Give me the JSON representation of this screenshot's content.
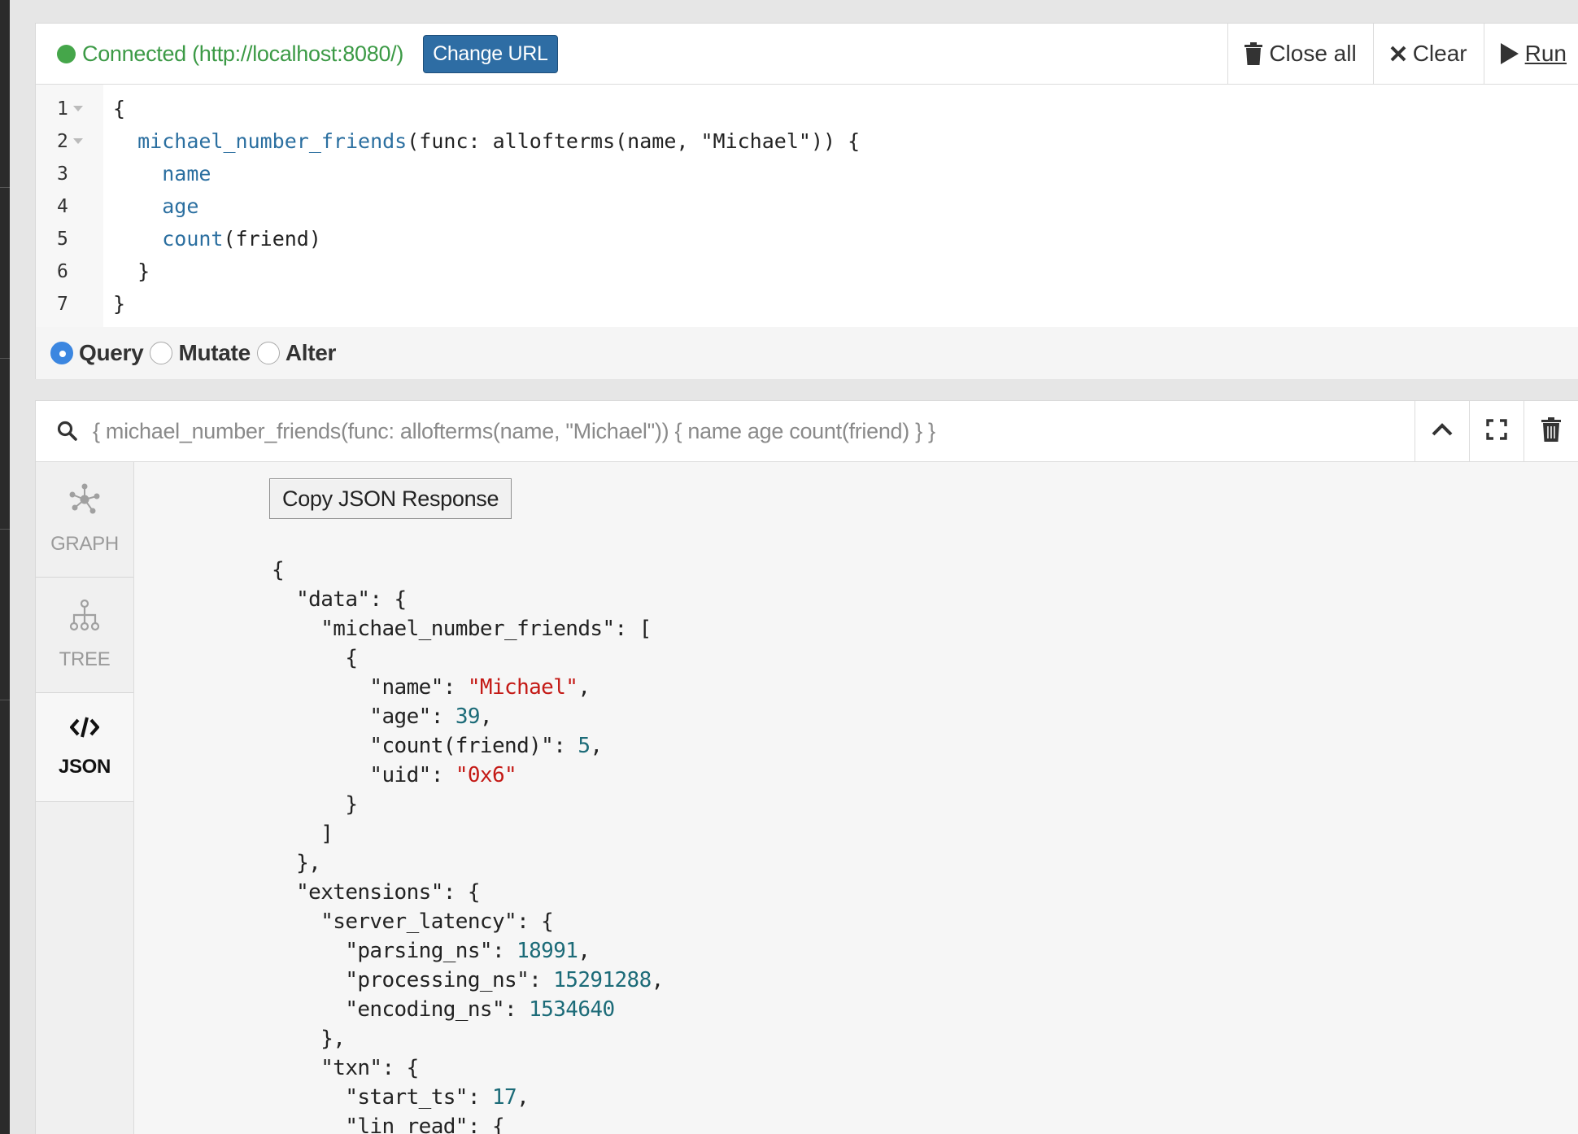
{
  "connection": {
    "status_text": "Connected (http://localhost:8080/)",
    "change_url_label": "Change URL"
  },
  "toolbar": {
    "close_all_label": "Close all",
    "clear_label": "Clear",
    "run_label": "Run"
  },
  "editor": {
    "line_numbers": [
      "1",
      "2",
      "3",
      "4",
      "5",
      "6",
      "7"
    ],
    "lines": [
      {
        "indent": "",
        "parts": [
          {
            "t": "{",
            "k": "plain"
          }
        ]
      },
      {
        "indent": "  ",
        "parts": [
          {
            "t": "michael_number_friends",
            "k": "kw"
          },
          {
            "t": "(func: allofterms(name, \"Michael\")) {",
            "k": "plain"
          }
        ]
      },
      {
        "indent": "    ",
        "parts": [
          {
            "t": "name",
            "k": "kw"
          }
        ]
      },
      {
        "indent": "    ",
        "parts": [
          {
            "t": "age",
            "k": "kw"
          }
        ]
      },
      {
        "indent": "    ",
        "parts": [
          {
            "t": "count",
            "k": "kw"
          },
          {
            "t": "(friend)",
            "k": "plain"
          }
        ]
      },
      {
        "indent": "  ",
        "parts": [
          {
            "t": "}",
            "k": "plain"
          }
        ]
      },
      {
        "indent": "",
        "parts": [
          {
            "t": "}",
            "k": "plain"
          }
        ]
      }
    ]
  },
  "modes": {
    "query": "Query",
    "mutate": "Mutate",
    "alter": "Alter",
    "selected": "query"
  },
  "result": {
    "query_summary": "{ michael_number_friends(func: allofterms(name, \"Michael\")) { name age count(friend) } }",
    "copy_label": "Copy JSON Response",
    "tabs": {
      "graph": "GRAPH",
      "tree": "TREE",
      "json": "JSON",
      "active": "json"
    },
    "json_lines": [
      [
        {
          "t": "{",
          "k": "p"
        }
      ],
      [
        {
          "t": "  \"data\": {",
          "k": "p"
        }
      ],
      [
        {
          "t": "    \"michael_number_friends\": [",
          "k": "p"
        }
      ],
      [
        {
          "t": "      {",
          "k": "p"
        }
      ],
      [
        {
          "t": "        \"name\": ",
          "k": "p"
        },
        {
          "t": "\"Michael\"",
          "k": "s"
        },
        {
          "t": ",",
          "k": "p"
        }
      ],
      [
        {
          "t": "        \"age\": ",
          "k": "p"
        },
        {
          "t": "39",
          "k": "n"
        },
        {
          "t": ",",
          "k": "p"
        }
      ],
      [
        {
          "t": "        \"count(friend)\": ",
          "k": "p"
        },
        {
          "t": "5",
          "k": "n"
        },
        {
          "t": ",",
          "k": "p"
        }
      ],
      [
        {
          "t": "        \"uid\": ",
          "k": "p"
        },
        {
          "t": "\"0x6\"",
          "k": "s"
        }
      ],
      [
        {
          "t": "      }",
          "k": "p"
        }
      ],
      [
        {
          "t": "    ]",
          "k": "p"
        }
      ],
      [
        {
          "t": "  },",
          "k": "p"
        }
      ],
      [
        {
          "t": "  \"extensions\": {",
          "k": "p"
        }
      ],
      [
        {
          "t": "    \"server_latency\": {",
          "k": "p"
        }
      ],
      [
        {
          "t": "      \"parsing_ns\": ",
          "k": "p"
        },
        {
          "t": "18991",
          "k": "n"
        },
        {
          "t": ",",
          "k": "p"
        }
      ],
      [
        {
          "t": "      \"processing_ns\": ",
          "k": "p"
        },
        {
          "t": "15291288",
          "k": "n"
        },
        {
          "t": ",",
          "k": "p"
        }
      ],
      [
        {
          "t": "      \"encoding_ns\": ",
          "k": "p"
        },
        {
          "t": "1534640",
          "k": "n"
        }
      ],
      [
        {
          "t": "    },",
          "k": "p"
        }
      ],
      [
        {
          "t": "    \"txn\": {",
          "k": "p"
        }
      ],
      [
        {
          "t": "      \"start_ts\": ",
          "k": "p"
        },
        {
          "t": "17",
          "k": "n"
        },
        {
          "t": ",",
          "k": "p"
        }
      ],
      [
        {
          "t": "      \"lin_read\": {",
          "k": "p"
        }
      ]
    ]
  },
  "colors": {
    "connected": "#3c9a46",
    "primary": "#2e6da4",
    "json_string": "#c41a16",
    "json_number": "#1c6b78",
    "keyword": "#2b6fa0"
  }
}
